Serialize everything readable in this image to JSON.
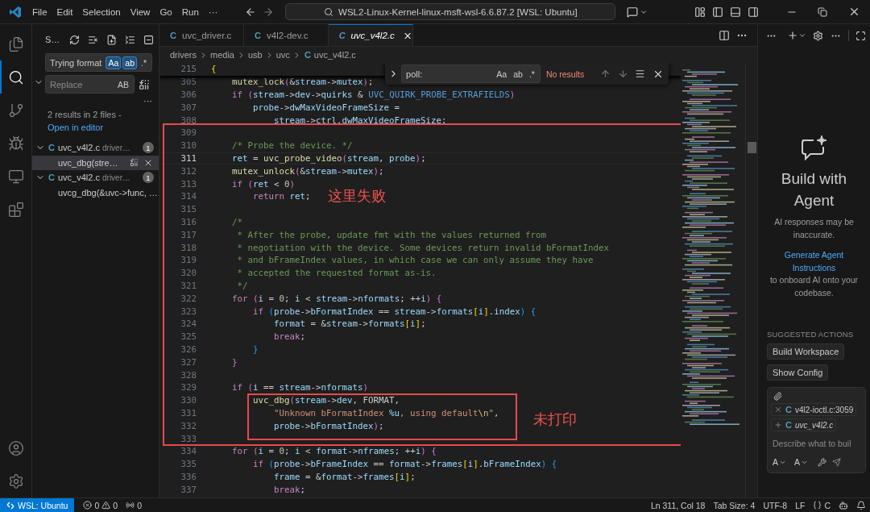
{
  "title_bar": {
    "menus": [
      "File",
      "Edit",
      "Selection",
      "View",
      "Go",
      "Run",
      "···"
    ],
    "command_center": "WSL2-Linux-Kernel-linux-msft-wsl-6.6.87.2 [WSL: Ubuntu]"
  },
  "activity_bar": {
    "items": [
      {
        "kind": "explorer",
        "selected": false
      },
      {
        "kind": "search",
        "selected": true
      },
      {
        "kind": "scm",
        "selected": false
      },
      {
        "kind": "debug",
        "selected": false
      },
      {
        "kind": "remote",
        "selected": false
      },
      {
        "kind": "extensions",
        "selected": false
      }
    ]
  },
  "search_view": {
    "title": "S…",
    "query": "Trying format",
    "query_toggles": [
      {
        "label": "Aa",
        "selected": true
      },
      {
        "label": "ab",
        "selected": true
      },
      {
        "label": ".*",
        "selected": false
      }
    ],
    "replace_placeholder": "Replace",
    "replace_toggle": "AB",
    "more": "···",
    "summary": "2 results in 2 files -",
    "open_link": "Open in editor",
    "results": [
      {
        "lang_icon": "C",
        "name": "uvc_v4l2.c",
        "path": "driver…",
        "count": "1",
        "expanded": true,
        "children": [
          {
            "text": "uvc_dbg(stre…",
            "selected": true
          }
        ]
      },
      {
        "lang_icon": "C",
        "name": "uvc_v4l2.c",
        "path": "driver…",
        "count": "1",
        "expanded": true,
        "children": [
          {
            "text": "uvcg_dbg(&uvc->func, …",
            "selected": false
          }
        ]
      }
    ]
  },
  "tabs": [
    {
      "lang_icon": "C",
      "label": "uvc_driver.c",
      "selected": false
    },
    {
      "lang_icon": "C",
      "label": "v4l2-dev.c",
      "selected": false
    },
    {
      "lang_icon": "C",
      "label": "uvc_v4l2.c",
      "selected": true
    }
  ],
  "breadcrumb": {
    "folders": [
      "drivers",
      "media",
      "usb",
      "uvc"
    ],
    "lang_icon": "C",
    "file": "uvc_v4l2.c"
  },
  "find_widget": {
    "value": "poll:",
    "toggles": [
      {
        "label": "Aa",
        "selected": false
      },
      {
        "label": "ab",
        "selected": false
      },
      {
        "label": ".*",
        "selected": false
      }
    ],
    "status": "No results"
  },
  "code": {
    "sticky_line": {
      "number": "215",
      "tokens": [
        {
          "kind": "bracket1",
          "text": "{"
        }
      ]
    },
    "lines": [
      {
        "number": "305",
        "current": false,
        "tokens": [
          {
            "kind": "function",
            "text": "    mutex_lock"
          },
          {
            "kind": "bracket2",
            "text": "("
          },
          {
            "kind": "plain",
            "text": "&"
          },
          {
            "kind": "variable",
            "text": "stream"
          },
          {
            "kind": "plain",
            "text": "->"
          },
          {
            "kind": "variable",
            "text": "mutex"
          },
          {
            "kind": "bracket2",
            "text": ")"
          },
          {
            "kind": "plain",
            "text": ";"
          }
        ]
      },
      {
        "number": "306",
        "current": false,
        "tokens": [
          {
            "kind": "keyword",
            "text": "    if"
          },
          {
            "kind": "bracket2",
            "text": " ("
          },
          {
            "kind": "variable",
            "text": "stream"
          },
          {
            "kind": "plain",
            "text": "->"
          },
          {
            "kind": "variable",
            "text": "dev"
          },
          {
            "kind": "plain",
            "text": "->"
          },
          {
            "kind": "variable",
            "text": "quirks"
          },
          {
            "kind": "plain",
            "text": " & "
          },
          {
            "kind": "macro",
            "text": "UVC_QUIRK_PROBE_EXTRAFIELDS"
          },
          {
            "kind": "bracket2",
            "text": ")"
          }
        ]
      },
      {
        "number": "307",
        "current": false,
        "tokens": [
          {
            "kind": "variable",
            "text": "        probe"
          },
          {
            "kind": "plain",
            "text": "->"
          },
          {
            "kind": "variable",
            "text": "dwMaxVideoFrameSize"
          },
          {
            "kind": "plain",
            "text": " ="
          }
        ]
      },
      {
        "number": "308",
        "current": false,
        "tokens": [
          {
            "kind": "variable",
            "text": "            stream"
          },
          {
            "kind": "plain",
            "text": "->"
          },
          {
            "kind": "variable",
            "text": "ctrl"
          },
          {
            "kind": "plain",
            "text": "."
          },
          {
            "kind": "variable",
            "text": "dwMaxVideoFrameSize"
          },
          {
            "kind": "plain",
            "text": ";"
          }
        ]
      },
      {
        "number": "309",
        "current": false
      },
      {
        "number": "310",
        "current": false,
        "tokens": [
          {
            "kind": "comment",
            "text": "    /* Probe the device. */"
          }
        ]
      },
      {
        "number": "311",
        "current": true,
        "tokens": [
          {
            "kind": "variable",
            "text": "    ret"
          },
          {
            "kind": "plain",
            "text": " = "
          },
          {
            "kind": "function",
            "text": "uvc_probe_video"
          },
          {
            "kind": "bracket2",
            "text": "("
          },
          {
            "kind": "variable",
            "text": "stream"
          },
          {
            "kind": "plain",
            "text": ", "
          },
          {
            "kind": "variable",
            "text": "probe"
          },
          {
            "kind": "bracket2",
            "text": ")"
          },
          {
            "kind": "plain",
            "text": ";"
          }
        ]
      },
      {
        "number": "312",
        "current": false,
        "tokens": [
          {
            "kind": "function",
            "text": "    mutex_unlock"
          },
          {
            "kind": "bracket2",
            "text": "("
          },
          {
            "kind": "plain",
            "text": "&"
          },
          {
            "kind": "variable",
            "text": "stream"
          },
          {
            "kind": "plain",
            "text": "->"
          },
          {
            "kind": "variable",
            "text": "mutex"
          },
          {
            "kind": "bracket2",
            "text": ")"
          },
          {
            "kind": "plain",
            "text": ";"
          }
        ]
      },
      {
        "number": "313",
        "current": false,
        "tokens": [
          {
            "kind": "keyword",
            "text": "    if"
          },
          {
            "kind": "bracket2",
            "text": " ("
          },
          {
            "kind": "variable",
            "text": "ret"
          },
          {
            "kind": "plain",
            "text": " < "
          },
          {
            "kind": "number",
            "text": "0"
          },
          {
            "kind": "bracket2",
            "text": ")"
          }
        ]
      },
      {
        "number": "314",
        "current": false,
        "tokens": [
          {
            "kind": "keyword",
            "text": "        return"
          },
          {
            "kind": "variable",
            "text": " ret"
          },
          {
            "kind": "plain",
            "text": ";"
          }
        ]
      },
      {
        "number": "315",
        "current": false
      },
      {
        "number": "316",
        "current": false,
        "tokens": [
          {
            "kind": "comment",
            "text": "    /*"
          }
        ]
      },
      {
        "number": "317",
        "current": false,
        "tokens": [
          {
            "kind": "comment",
            "text": "     * After the probe, update fmt with the values returned from"
          }
        ]
      },
      {
        "number": "318",
        "current": false,
        "tokens": [
          {
            "kind": "comment",
            "text": "     * negotiation with the device. Some devices return invalid bFormatIndex"
          }
        ]
      },
      {
        "number": "319",
        "current": false,
        "tokens": [
          {
            "kind": "comment",
            "text": "     * and bFrameIndex values, in which case we can only assume they have"
          }
        ]
      },
      {
        "number": "320",
        "current": false,
        "tokens": [
          {
            "kind": "comment",
            "text": "     * accepted the requested format as-is."
          }
        ]
      },
      {
        "number": "321",
        "current": false,
        "tokens": [
          {
            "kind": "comment",
            "text": "     */"
          }
        ]
      },
      {
        "number": "322",
        "current": false,
        "tokens": [
          {
            "kind": "keyword",
            "text": "    for"
          },
          {
            "kind": "bracket2",
            "text": " ("
          },
          {
            "kind": "variable",
            "text": "i"
          },
          {
            "kind": "plain",
            "text": " = "
          },
          {
            "kind": "number",
            "text": "0"
          },
          {
            "kind": "plain",
            "text": "; "
          },
          {
            "kind": "variable",
            "text": "i"
          },
          {
            "kind": "plain",
            "text": " < "
          },
          {
            "kind": "variable",
            "text": "stream"
          },
          {
            "kind": "plain",
            "text": "->"
          },
          {
            "kind": "variable",
            "text": "nformats"
          },
          {
            "kind": "plain",
            "text": "; ++"
          },
          {
            "kind": "variable",
            "text": "i"
          },
          {
            "kind": "bracket2",
            "text": ")"
          },
          {
            "kind": "bracket2",
            "text": " {"
          }
        ]
      },
      {
        "number": "323",
        "current": false,
        "tokens": [
          {
            "kind": "keyword",
            "text": "        if"
          },
          {
            "kind": "bracket3",
            "text": " ("
          },
          {
            "kind": "variable",
            "text": "probe"
          },
          {
            "kind": "plain",
            "text": "->"
          },
          {
            "kind": "variable",
            "text": "bFormatIndex"
          },
          {
            "kind": "plain",
            "text": " == "
          },
          {
            "kind": "variable",
            "text": "stream"
          },
          {
            "kind": "plain",
            "text": "->"
          },
          {
            "kind": "variable",
            "text": "formats"
          },
          {
            "kind": "bracket1",
            "text": "["
          },
          {
            "kind": "variable",
            "text": "i"
          },
          {
            "kind": "bracket1",
            "text": "]"
          },
          {
            "kind": "plain",
            "text": "."
          },
          {
            "kind": "variable",
            "text": "index"
          },
          {
            "kind": "bracket3",
            "text": ")"
          },
          {
            "kind": "bracket3",
            "text": " {"
          }
        ]
      },
      {
        "number": "324",
        "current": false,
        "tokens": [
          {
            "kind": "variable",
            "text": "            format"
          },
          {
            "kind": "plain",
            "text": " = &"
          },
          {
            "kind": "variable",
            "text": "stream"
          },
          {
            "kind": "plain",
            "text": "->"
          },
          {
            "kind": "variable",
            "text": "formats"
          },
          {
            "kind": "bracket1",
            "text": "["
          },
          {
            "kind": "variable",
            "text": "i"
          },
          {
            "kind": "bracket1",
            "text": "]"
          },
          {
            "kind": "plain",
            "text": ";"
          }
        ]
      },
      {
        "number": "325",
        "current": false,
        "tokens": [
          {
            "kind": "keyword",
            "text": "            break"
          },
          {
            "kind": "plain",
            "text": ";"
          }
        ]
      },
      {
        "number": "326",
        "current": false,
        "tokens": [
          {
            "kind": "bracket3",
            "text": "        }"
          }
        ]
      },
      {
        "number": "327",
        "current": false,
        "tokens": [
          {
            "kind": "bracket2",
            "text": "    }"
          }
        ]
      },
      {
        "number": "328",
        "current": false
      },
      {
        "number": "329",
        "current": false,
        "tokens": [
          {
            "kind": "keyword",
            "text": "    if"
          },
          {
            "kind": "bracket2",
            "text": " ("
          },
          {
            "kind": "variable",
            "text": "i"
          },
          {
            "kind": "plain",
            "text": " == "
          },
          {
            "kind": "variable",
            "text": "stream"
          },
          {
            "kind": "plain",
            "text": "->"
          },
          {
            "kind": "variable",
            "text": "nformats"
          },
          {
            "kind": "bracket2",
            "text": ")"
          }
        ]
      },
      {
        "number": "330",
        "current": false,
        "tokens": [
          {
            "kind": "function",
            "text": "        uvc_dbg"
          },
          {
            "kind": "bracket2",
            "text": "("
          },
          {
            "kind": "variable",
            "text": "stream"
          },
          {
            "kind": "plain",
            "text": "->"
          },
          {
            "kind": "variable",
            "text": "dev"
          },
          {
            "kind": "plain",
            "text": ", FORMAT,"
          }
        ]
      },
      {
        "number": "331",
        "current": false,
        "tokens": [
          {
            "kind": "string",
            "text": "            \"Unknown bFormatIndex "
          },
          {
            "kind": "variable",
            "text": "%u"
          },
          {
            "kind": "string",
            "text": ", using default"
          },
          {
            "kind": "escape",
            "text": "\\n"
          },
          {
            "kind": "string",
            "text": "\""
          },
          {
            "kind": "plain",
            "text": ","
          }
        ]
      },
      {
        "number": "332",
        "current": false,
        "tokens": [
          {
            "kind": "variable",
            "text": "            probe"
          },
          {
            "kind": "plain",
            "text": "->"
          },
          {
            "kind": "variable",
            "text": "bFormatIndex"
          },
          {
            "kind": "bracket2",
            "text": ")"
          },
          {
            "kind": "plain",
            "text": ";"
          }
        ]
      },
      {
        "number": "333",
        "current": false
      },
      {
        "number": "334",
        "current": false,
        "tokens": [
          {
            "kind": "keyword",
            "text": "    for"
          },
          {
            "kind": "bracket2",
            "text": " ("
          },
          {
            "kind": "variable",
            "text": "i"
          },
          {
            "kind": "plain",
            "text": " = "
          },
          {
            "kind": "number",
            "text": "0"
          },
          {
            "kind": "plain",
            "text": "; "
          },
          {
            "kind": "variable",
            "text": "i"
          },
          {
            "kind": "plain",
            "text": " < "
          },
          {
            "kind": "variable",
            "text": "format"
          },
          {
            "kind": "plain",
            "text": "->"
          },
          {
            "kind": "variable",
            "text": "nframes"
          },
          {
            "kind": "plain",
            "text": "; ++"
          },
          {
            "kind": "variable",
            "text": "i"
          },
          {
            "kind": "bracket2",
            "text": ")"
          },
          {
            "kind": "bracket2",
            "text": " {"
          }
        ]
      },
      {
        "number": "335",
        "current": false,
        "tokens": [
          {
            "kind": "keyword",
            "text": "        if"
          },
          {
            "kind": "bracket3",
            "text": " ("
          },
          {
            "kind": "variable",
            "text": "probe"
          },
          {
            "kind": "plain",
            "text": "->"
          },
          {
            "kind": "variable",
            "text": "bFrameIndex"
          },
          {
            "kind": "plain",
            "text": " == "
          },
          {
            "kind": "variable",
            "text": "format"
          },
          {
            "kind": "plain",
            "text": "->"
          },
          {
            "kind": "variable",
            "text": "frames"
          },
          {
            "kind": "bracket1",
            "text": "["
          },
          {
            "kind": "variable",
            "text": "i"
          },
          {
            "kind": "bracket1",
            "text": "]"
          },
          {
            "kind": "plain",
            "text": "."
          },
          {
            "kind": "variable",
            "text": "bFrameIndex"
          },
          {
            "kind": "bracket3",
            "text": ")"
          },
          {
            "kind": "bracket3",
            "text": " {"
          }
        ]
      },
      {
        "number": "336",
        "current": false,
        "tokens": [
          {
            "kind": "variable",
            "text": "            frame"
          },
          {
            "kind": "plain",
            "text": " = &"
          },
          {
            "kind": "variable",
            "text": "format"
          },
          {
            "kind": "plain",
            "text": "->"
          },
          {
            "kind": "variable",
            "text": "frames"
          },
          {
            "kind": "bracket1",
            "text": "["
          },
          {
            "kind": "variable",
            "text": "i"
          },
          {
            "kind": "bracket1",
            "text": "]"
          },
          {
            "kind": "plain",
            "text": ";"
          }
        ]
      },
      {
        "number": "337",
        "current": false,
        "tokens": [
          {
            "kind": "keyword",
            "text": "            break"
          },
          {
            "kind": "plain",
            "text": ";"
          }
        ]
      }
    ]
  },
  "annotations": [
    {
      "note": "这里失败"
    },
    {
      "note": "未打印"
    }
  ],
  "chat_panel": {
    "heading": "Build with Agent",
    "disclaimer": "AI responses may be inaccurate.",
    "link": "Generate Agent Instructions",
    "after_link": " to onboard AI onto your codebase.",
    "suggested_title": "SUGGESTED ACTIONS",
    "actions": [
      "Build Workspace",
      "Show Config"
    ],
    "context": [
      {
        "kind": "attached",
        "lang_icon": "C",
        "name": "v4l2-ioctl.c:3059"
      },
      {
        "kind": "suggested",
        "lang_icon": "C",
        "name": "uvc_v4l2.c"
      }
    ],
    "placeholder": "Describe what to buil",
    "mode": "A",
    "model": "A"
  },
  "status_bar": {
    "remote": "WSL: Ubuntu",
    "errors": "0",
    "warnings": "0",
    "ports": "0",
    "position": "Ln 311, Col 18",
    "tab_size": "Tab Size: 4",
    "encoding": "UTF-8",
    "eol": "LF",
    "language": "C"
  }
}
